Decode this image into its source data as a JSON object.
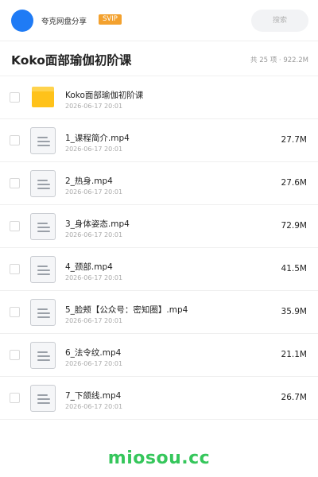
{
  "header": {
    "username": "夸克网盘分享",
    "badge": "SVIP",
    "search_placeholder": "搜索"
  },
  "title_bar": {
    "title": "Koko面部瑜伽初阶课",
    "summary": "共 25 项 · 922.2M"
  },
  "files": [
    {
      "name": "Koko面部瑜伽初阶课",
      "date": "2026-06-17 20:01",
      "size": "",
      "icon": "folder-icon"
    },
    {
      "name": "1_课程简介.mp4",
      "date": "2026-06-17 20:01",
      "size": "27.7M",
      "icon": "file-icon"
    },
    {
      "name": "2_热身.mp4",
      "date": "2026-06-17 20:01",
      "size": "27.6M",
      "icon": "file-icon"
    },
    {
      "name": "3_身体姿态.mp4",
      "date": "2026-06-17 20:01",
      "size": "72.9M",
      "icon": "file-icon"
    },
    {
      "name": "4_颈部.mp4",
      "date": "2026-06-17 20:01",
      "size": "41.5M",
      "icon": "file-icon"
    },
    {
      "name": "5_脸颊【公众号：密知圈】.mp4",
      "date": "2026-06-17 20:01",
      "size": "35.9M",
      "icon": "file-icon"
    },
    {
      "name": "6_法令纹.mp4",
      "date": "2026-06-17 20:01",
      "size": "21.1M",
      "icon": "file-icon"
    },
    {
      "name": "7_下颌线.mp4",
      "date": "2026-06-17 20:01",
      "size": "26.7M",
      "icon": "file-icon"
    }
  ],
  "watermark": "miosou.cc",
  "colors": {
    "accent_blue": "#1f7bf5",
    "svip_orange": "#f3a12e",
    "folder_yellow": "#ffc21a",
    "watermark_green": "#35c65b"
  }
}
